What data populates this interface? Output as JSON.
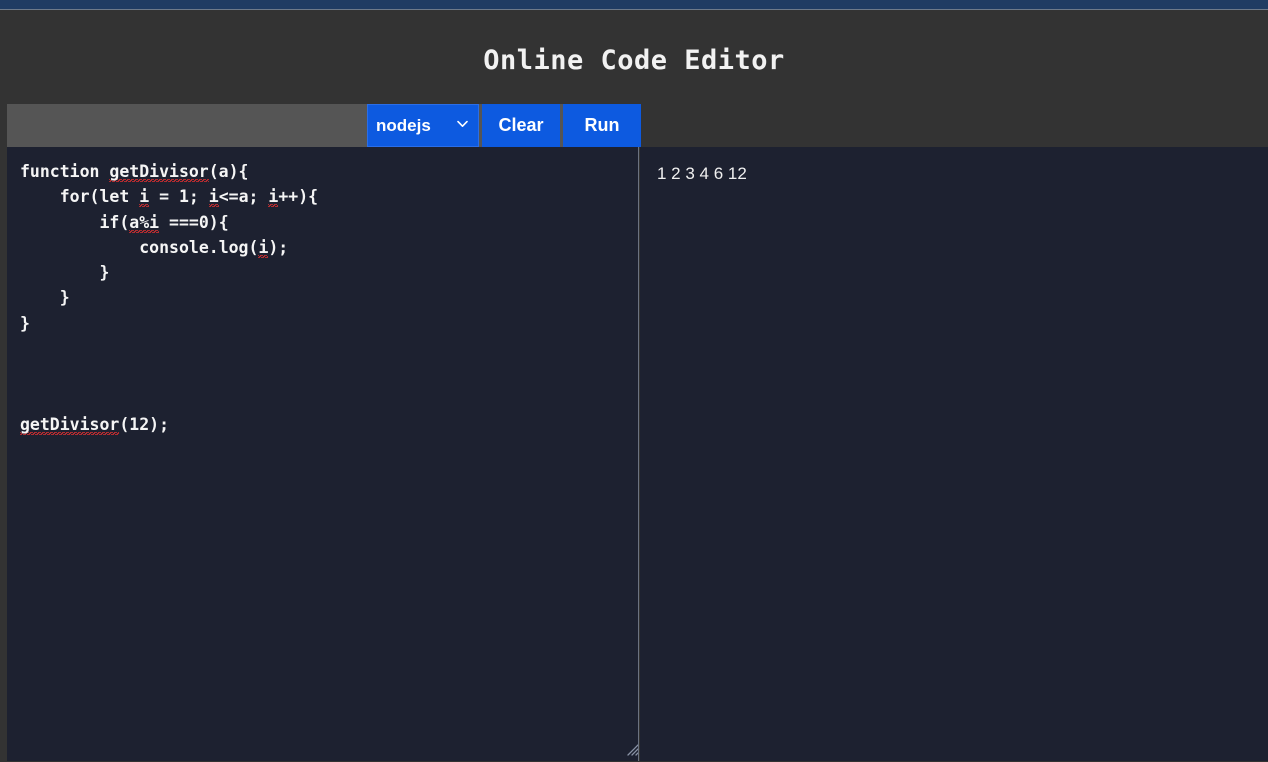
{
  "browser": {
    "chrome_bar_color": "#203c63"
  },
  "page": {
    "background_color": "#333333",
    "title": "Online Code Editor"
  },
  "toolbar": {
    "background_color": "#555555",
    "accent_color": "#0d5ae0",
    "language_select": {
      "selected": "nodejs",
      "chevron": "⌄",
      "options": [
        "nodejs"
      ]
    },
    "clear_label": "Clear",
    "run_label": "Run"
  },
  "editor": {
    "background_color": "#1d2130",
    "text_color": "#f5f5f5",
    "placeholder": "",
    "lines": [
      {
        "indent": 0,
        "parts": [
          {
            "t": "function ",
            "sq": false
          },
          {
            "t": "getDivisor",
            "sq": true
          },
          {
            "t": "(a){",
            "sq": false
          }
        ]
      },
      {
        "indent": 1,
        "parts": [
          {
            "t": "for(let ",
            "sq": false
          },
          {
            "t": "i",
            "sq": true
          },
          {
            "t": " = 1; ",
            "sq": false
          },
          {
            "t": "i",
            "sq": true
          },
          {
            "t": "<=a; ",
            "sq": false
          },
          {
            "t": "i",
            "sq": true
          },
          {
            "t": "++){",
            "sq": false
          }
        ]
      },
      {
        "indent": 2,
        "parts": [
          {
            "t": "if(",
            "sq": false
          },
          {
            "t": "a%i",
            "sq": true
          },
          {
            "t": " ===0){",
            "sq": false
          }
        ]
      },
      {
        "indent": 3,
        "parts": [
          {
            "t": "console.log(",
            "sq": false
          },
          {
            "t": "i",
            "sq": true
          },
          {
            "t": ");",
            "sq": false
          }
        ]
      },
      {
        "indent": 2,
        "parts": [
          {
            "t": "}",
            "sq": false
          }
        ]
      },
      {
        "indent": 1,
        "parts": [
          {
            "t": "}",
            "sq": false
          }
        ]
      },
      {
        "indent": 0,
        "parts": [
          {
            "t": "}",
            "sq": false
          }
        ]
      },
      {
        "indent": 0,
        "parts": [
          {
            "t": "",
            "sq": false
          }
        ]
      },
      {
        "indent": 0,
        "parts": [
          {
            "t": "",
            "sq": false
          }
        ]
      },
      {
        "indent": 0,
        "parts": [
          {
            "t": "",
            "sq": false
          }
        ]
      },
      {
        "indent": 0,
        "parts": [
          {
            "t": "getDivisor",
            "sq": true
          },
          {
            "t": "(12);",
            "sq": false
          }
        ]
      }
    ],
    "raw_value": "function getDivisor(a){\n    for(let i = 1; i<=a; i++){\n        if(a%i ===0){\n            console.log(i);\n        }\n    }\n}\n\n\n\ngetDivisor(12);",
    "resize_handle": "resize-grip-icon"
  },
  "output": {
    "background_color": "#1d2130",
    "text": "1 2 3 4 6 12"
  }
}
